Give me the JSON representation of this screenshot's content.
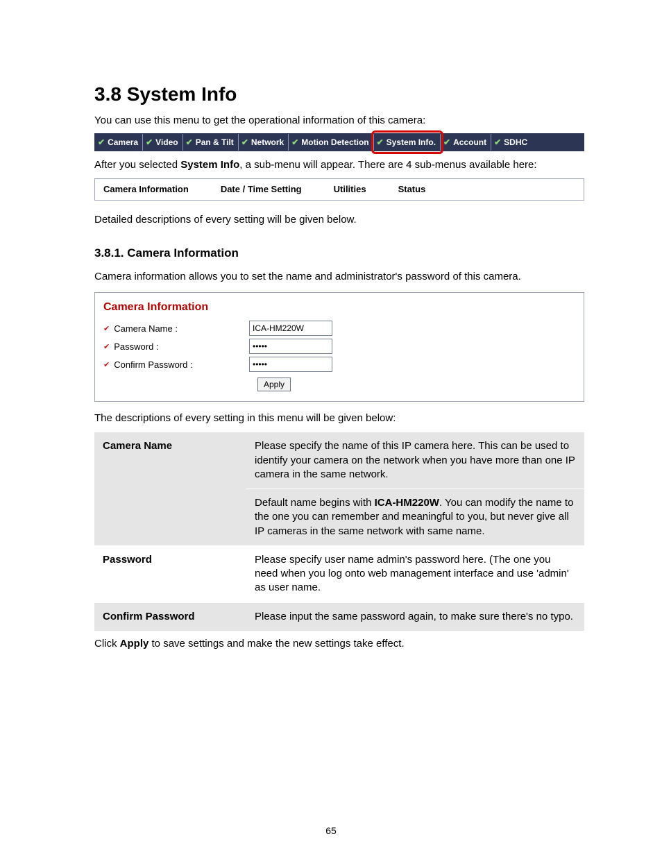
{
  "heading": "3.8  System Info",
  "intro": "You can use this menu to get the operational information of this camera:",
  "menu": {
    "items": [
      "Camera",
      "Video",
      "Pan & Tilt",
      "Network",
      "Motion Detection",
      "System Info.",
      "Account",
      "SDHC"
    ],
    "highlight_index": 5
  },
  "after_menu_text_pre": "After you selected ",
  "after_menu_bold": "System Info",
  "after_menu_text_post": ", a sub-menu will appear. There are 4 sub-menus available here:",
  "submenu": [
    "Camera Information",
    "Date / Time Setting",
    "Utilities",
    "Status"
  ],
  "detailed_line": "Detailed descriptions of every setting will be given below.",
  "sub_heading": "3.8.1.  Camera Information",
  "sub_intro": "Camera information allows you to set the name and administrator's password of this camera.",
  "form": {
    "title": "Camera Information",
    "camera_name_label": "Camera Name :",
    "camera_name_value": "ICA-HM220W",
    "password_label": "Password :",
    "password_value": "•••••",
    "confirm_label": "Confirm Password :",
    "confirm_value": "•••••",
    "apply_label": "Apply"
  },
  "desc_intro": "The descriptions of every setting in this menu will be given below:",
  "table": {
    "row1_label": "Camera Name",
    "row1_p1": "Please specify the name of this IP camera here. This can be used to identify your camera on the network when you have more than one IP camera in the same network.",
    "row1_p2_pre": "Default name begins with ",
    "row1_p2_bold": "ICA-HM220W",
    "row1_p2_post": ". You can modify the name to the one you can remember and meaningful to you, but never give all IP cameras in the same network with same name.",
    "row2_label": "Password",
    "row2_p1": "Please specify user name admin's password here. (The one you need when you log onto web management interface and use 'admin' as user name.",
    "row3_label": "Confirm Password",
    "row3_p1": "Please input the same password again, to make sure there's no typo."
  },
  "closing_pre": "Click ",
  "closing_bold": "Apply",
  "closing_post": " to save settings and make the new settings take effect.",
  "page_number": "65"
}
